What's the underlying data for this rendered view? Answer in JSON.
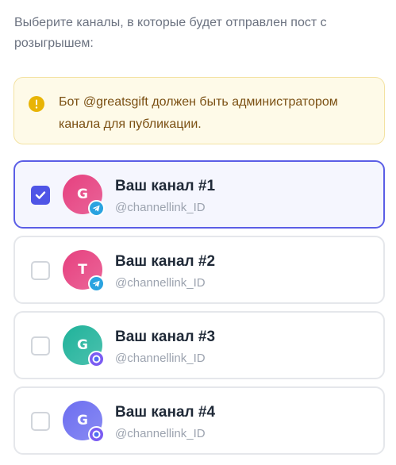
{
  "intro_text": "Выберите каналы, в которые будет отправлен пост с розыгрышем:",
  "alert": {
    "text": "Бот @greatsgift должен быть администратором канала для публикации.",
    "icon": "info-icon",
    "background": "#fefae8",
    "icon_color": "#e8b406"
  },
  "channels": [
    {
      "name": "Ваш канал #1",
      "handle": "@channellink_ID",
      "initial": "G",
      "selected": true,
      "platform": "telegram",
      "avatar_color": "#e6407f"
    },
    {
      "name": "Ваш канал #2",
      "handle": "@channellink_ID",
      "initial": "T",
      "selected": false,
      "platform": "telegram",
      "avatar_color": "#e6407f"
    },
    {
      "name": "Ваш канал #3",
      "handle": "@channellink_ID",
      "initial": "G",
      "selected": false,
      "platform": "other",
      "avatar_color": "#1fb29a"
    },
    {
      "name": "Ваш канал #4",
      "handle": "@channellink_ID",
      "initial": "G",
      "selected": false,
      "platform": "other",
      "avatar_color": "#6c6ef0"
    }
  ],
  "colors": {
    "accent": "#4f55e6",
    "selected_border": "#5b5ee6",
    "selected_background": "#f5f6fe"
  }
}
